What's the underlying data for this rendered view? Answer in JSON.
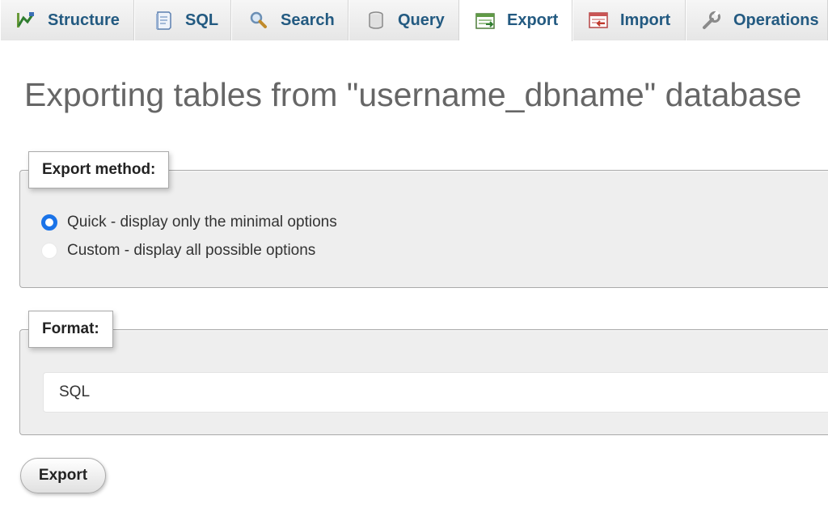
{
  "tabs": [
    {
      "label": "Structure",
      "icon": "structure-icon",
      "active": false
    },
    {
      "label": "SQL",
      "icon": "sql-icon",
      "active": false
    },
    {
      "label": "Search",
      "icon": "search-icon",
      "active": false
    },
    {
      "label": "Query",
      "icon": "query-icon",
      "active": false
    },
    {
      "label": "Export",
      "icon": "export-icon",
      "active": true
    },
    {
      "label": "Import",
      "icon": "import-icon",
      "active": false
    },
    {
      "label": "Operations",
      "icon": "operations-icon",
      "active": false
    }
  ],
  "page": {
    "title": "Exporting tables from \"username_dbname\" database"
  },
  "export_method": {
    "legend": "Export method:",
    "options": [
      {
        "label": "Quick - display only the minimal options",
        "checked": true
      },
      {
        "label": "Custom - display all possible options",
        "checked": false
      }
    ]
  },
  "format": {
    "legend": "Format:",
    "selected": "SQL"
  },
  "actions": {
    "export_label": "Export"
  },
  "colors": {
    "tab_text": "#235a81",
    "radio_accent": "#1a73e8",
    "title_text": "#666666",
    "fieldset_bg": "#eeeeee"
  }
}
